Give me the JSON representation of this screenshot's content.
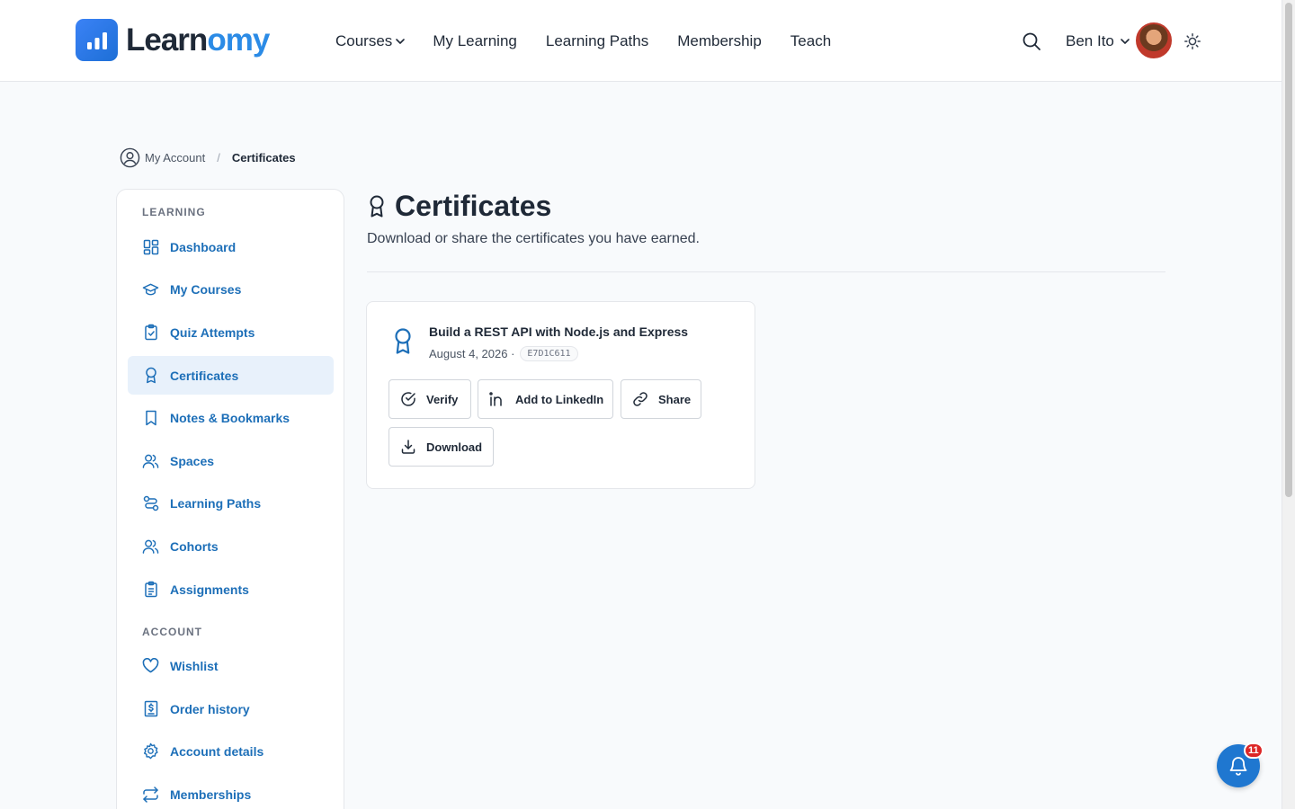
{
  "brand": {
    "name_part1": "Learn",
    "name_part2": "omy",
    "accent": "#2b8be6"
  },
  "nav": {
    "items": [
      {
        "label": "Courses",
        "has_dropdown": true
      },
      {
        "label": "My Learning"
      },
      {
        "label": "Learning Paths"
      },
      {
        "label": "Membership"
      },
      {
        "label": "Teach"
      }
    ]
  },
  "header": {
    "user_name": "Ben Ito"
  },
  "breadcrumb": {
    "parent": "My Account",
    "separator": "/",
    "current": "Certificates"
  },
  "sidebar": {
    "learning_heading": "LEARNING",
    "learning_items": [
      {
        "label": "Dashboard",
        "icon": "dashboard-icon"
      },
      {
        "label": "My Courses",
        "icon": "graduation-cap-icon"
      },
      {
        "label": "Quiz Attempts",
        "icon": "clipboard-check-icon"
      },
      {
        "label": "Certificates",
        "icon": "award-icon",
        "active": true
      },
      {
        "label": "Notes & Bookmarks",
        "icon": "bookmark-icon"
      },
      {
        "label": "Spaces",
        "icon": "users-icon"
      },
      {
        "label": "Learning Paths",
        "icon": "route-icon"
      },
      {
        "label": "Cohorts",
        "icon": "user-group-icon"
      },
      {
        "label": "Assignments",
        "icon": "clipboard-list-icon"
      }
    ],
    "account_heading": "ACCOUNT",
    "account_items": [
      {
        "label": "Wishlist",
        "icon": "heart-icon"
      },
      {
        "label": "Order history",
        "icon": "receipt-icon"
      },
      {
        "label": "Account details",
        "icon": "gear-icon"
      },
      {
        "label": "Memberships",
        "icon": "repeat-icon"
      }
    ]
  },
  "main": {
    "title": "Certificates",
    "subtitle": "Download or share the certificates you have earned."
  },
  "certificate": {
    "title": "Build a REST API with Node.js and Express",
    "date": "August 4, 2026 ·",
    "code": "E7D1C611",
    "buttons": {
      "verify": "Verify",
      "linkedin": "Add to LinkedIn",
      "share": "Share",
      "download": "Download"
    }
  },
  "notifications": {
    "count": "11"
  }
}
